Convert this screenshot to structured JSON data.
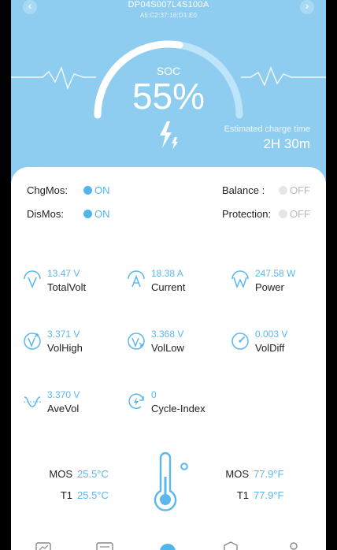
{
  "header": {
    "device_name": "DP04S007L4S100A",
    "mac": "A5:C2:37:16:D1:E0",
    "prev_icon": "chevron-left-icon",
    "next_icon": "chevron-right-icon"
  },
  "soc": {
    "label": "SOC",
    "value": "55%",
    "level": 0.55
  },
  "charge": {
    "label": "Estimated charge time",
    "value": "2H 30m"
  },
  "status": {
    "chgmos": {
      "label": "ChgMos:",
      "state": "ON"
    },
    "dismos": {
      "label": "DisMos:",
      "state": "ON"
    },
    "balance": {
      "label": "Balance :",
      "state": "OFF"
    },
    "protection": {
      "label": "Protection:",
      "state": "OFF"
    }
  },
  "metrics": {
    "total_volt": {
      "value": "13.47 V",
      "label": "TotalVolt",
      "icon": "voltage-icon"
    },
    "current": {
      "value": "18.38 A",
      "label": "Current",
      "icon": "current-icon"
    },
    "power": {
      "value": "247.58 W",
      "label": "Power",
      "icon": "power-icon"
    },
    "vol_high": {
      "value": "3.371 V",
      "label": "VolHigh",
      "icon": "voltage-high-icon"
    },
    "vol_low": {
      "value": "3.368 V",
      "label": "VolLow",
      "icon": "voltage-low-icon"
    },
    "vol_diff": {
      "value": "0.003 V",
      "label": "VolDiff",
      "icon": "gauge-icon"
    },
    "ave_vol": {
      "value": "3.370 V",
      "label": "AveVol",
      "icon": "wave-icon"
    },
    "cycle_index": {
      "value": "0",
      "label": "Cycle-Index",
      "icon": "cycle-icon"
    }
  },
  "temps": {
    "celsius": [
      {
        "label": "MOS",
        "value": "25.5°C"
      },
      {
        "label": "T1",
        "value": "25.5°C"
      }
    ],
    "fahrenheit": [
      {
        "label": "MOS",
        "value": "77.9°F"
      },
      {
        "label": "T1",
        "value": "77.9°F"
      }
    ]
  },
  "colors": {
    "header_bg": "#8fcdf0",
    "accent": "#52b5ec",
    "value_text": "#5ab8ee",
    "off": "#b9b9b9"
  }
}
